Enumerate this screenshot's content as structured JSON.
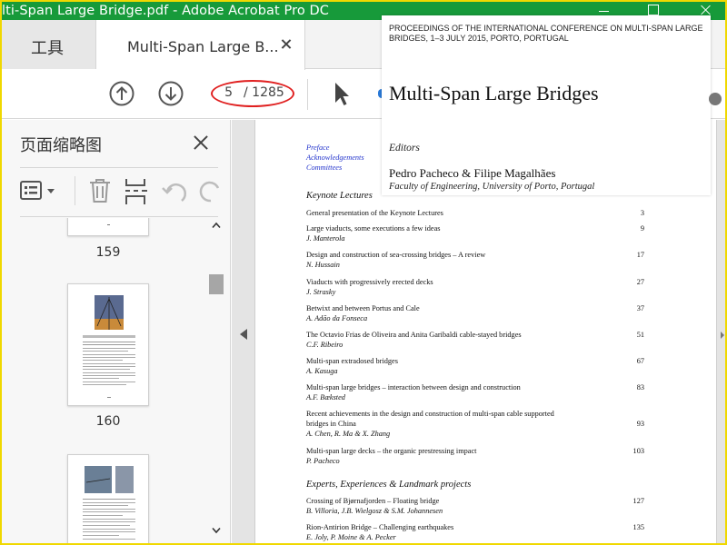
{
  "window": {
    "title": "lti-Span Large Bridge.pdf - Adobe Acrobat Pro DC"
  },
  "tabs": {
    "tools_label": "工具",
    "doc_label": "Multi-Span Large B..."
  },
  "toolbar": {
    "page_current": "5",
    "page_total": "/ 1285"
  },
  "thumbnail_panel": {
    "title": "页面缩略图",
    "pages": [
      "159",
      "160"
    ]
  },
  "document": {
    "front_links": [
      "Preface",
      "Acknowledgements",
      "Committees"
    ],
    "section1": "Keynote Lectures",
    "entries": [
      {
        "title": "General presentation of the Keynote Lectures",
        "title2": "",
        "authors": "",
        "page": "3"
      },
      {
        "title": "Large viaducts, some executions a few ideas",
        "title2": "",
        "authors": "J. Manterola",
        "page": "9"
      },
      {
        "title": "Design and construction of sea-crossing bridges – A review",
        "title2": "",
        "authors": "N. Hussain",
        "page": "17"
      },
      {
        "title": "Viaducts with progressively erected decks",
        "title2": "",
        "authors": "J. Strasky",
        "page": "27"
      },
      {
        "title": "Betwixt and between Portus and Cale",
        "title2": "",
        "authors": "A. Adão da Fonseca",
        "page": "37"
      },
      {
        "title": "The Octavio Frias de Oliveira and Anita Garibaldi cable-stayed bridges",
        "title2": "",
        "authors": "C.F. Ribeiro",
        "page": "51"
      },
      {
        "title": "Multi-span extradosed bridges",
        "title2": "",
        "authors": "A. Kasuga",
        "page": "67"
      },
      {
        "title": "Multi-span large bridges – interaction between design and construction",
        "title2": "",
        "authors": "A.F. Bæksted",
        "page": "83"
      },
      {
        "title": "Recent achievements in the design and construction of multi-span cable supported",
        "title2": "bridges in China",
        "authors": "A. Chen, R. Ma & X. Zhang",
        "page": "93"
      },
      {
        "title": "Multi-span large decks – the organic prestressing impact",
        "title2": "",
        "authors": "P. Pacheco",
        "page": "103"
      }
    ],
    "section2": "Experts, Experiences & Landmark projects",
    "entries2": [
      {
        "title": "Crossing of Bjørnafjorden – Floating bridge",
        "authors": "B. Villoria, J.B. Wielgosz & S.M. Johannesen",
        "page": "127"
      },
      {
        "title": "Rion-Antirion Bridge – Challenging earthquakes",
        "authors": "E. Joly, P. Moine & A. Pecker",
        "page": "135"
      }
    ]
  },
  "cover_overlay": {
    "header": "PROCEEDINGS OF THE INTERNATIONAL CONFERENCE ON MULTI-SPAN LARGE BRIDGES, 1–3 JULY 2015, PORTO, PORTUGAL",
    "title": "Multi-Span Large Bridges",
    "editors_label": "Editors",
    "editors": "Pedro Pacheco & Filipe Magalhães",
    "affiliation": "Faculty of Engineering, University of Porto, Portugal"
  },
  "colors": {
    "titlebar": "#179a3a",
    "frame": "#f0d800",
    "highlight": "#e02020",
    "link": "#2233cc"
  },
  "icons": [
    "arrow-up-circle-icon",
    "arrow-down-circle-icon",
    "cursor-arrow-icon",
    "thumbnail-options-icon",
    "trash-icon",
    "insert-page-icon",
    "undo-icon",
    "redo-icon",
    "close-icon"
  ]
}
